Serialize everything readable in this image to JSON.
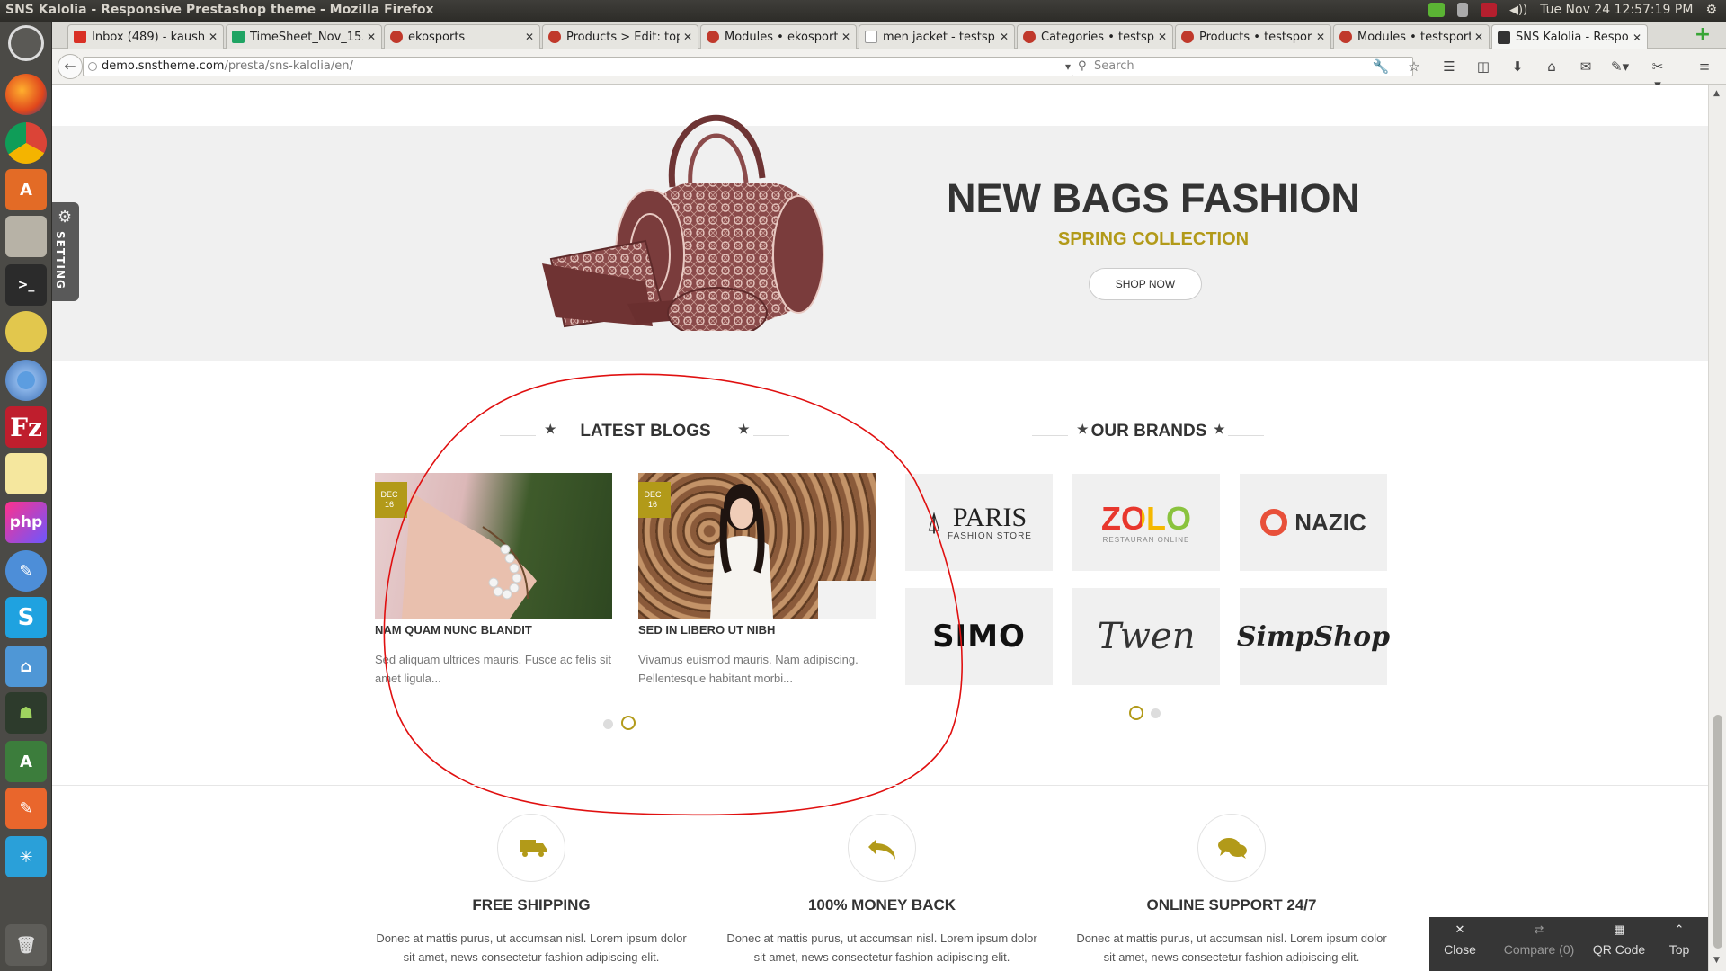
{
  "os": {
    "window_title": "SNS Kalolia - Responsive Prestashop theme - Mozilla Firefox",
    "clock": "Tue Nov 24 12:57:19 PM"
  },
  "tabs": [
    {
      "label": "Inbox (489) - kausha...",
      "favicon": "gmail-icon",
      "color": "#d93025"
    },
    {
      "label": "TimeSheet_Nov_15...",
      "favicon": "drive-icon",
      "color": "#1fa463"
    },
    {
      "label": "ekosports",
      "favicon": "prestashop-icon",
      "color": "#c0392b"
    },
    {
      "label": "Products > Edit: top...",
      "favicon": "prestashop-icon",
      "color": "#c0392b"
    },
    {
      "label": "Modules • ekosports",
      "favicon": "prestashop-icon",
      "color": "#c0392b"
    },
    {
      "label": "men jacket - testsp...",
      "favicon": "unknown-page-icon",
      "color": "#888888"
    },
    {
      "label": "Categories • testsp...",
      "favicon": "prestashop-icon",
      "color": "#c0392b"
    },
    {
      "label": "Products • testsports",
      "favicon": "prestashop-icon",
      "color": "#c0392b"
    },
    {
      "label": "Modules • testsports",
      "favicon": "prestashop-icon",
      "color": "#c0392b"
    },
    {
      "label": "SNS Kalolia - Respo...",
      "favicon": "sns-icon",
      "color": "#333333"
    }
  ],
  "navbar": {
    "url_domain": "demo.snstheme.com",
    "url_path": "/presta/sns-kalolia/en/",
    "search_placeholder": "Search"
  },
  "banner": {
    "setting_label": "SETTING",
    "title": "NEW BAGS FASHION",
    "subtitle": "SPRING COLLECTION",
    "cta": "SHOP NOW"
  },
  "blogs": {
    "heading": "LATEST BLOGS",
    "posts": [
      {
        "month": "DEC",
        "day": "16",
        "title": "NAM QUAM NUNC BLANDIT",
        "excerpt": "Sed aliquam ultrices mauris. Fusce ac felis sit amet ligula..."
      },
      {
        "month": "DEC",
        "day": "16",
        "title": "SED IN LIBERO UT NIBH",
        "excerpt": "Vivamus euismod mauris. Nam adipiscing. Pellentesque habitant morbi..."
      }
    ]
  },
  "brands": {
    "heading": "OUR BRANDS",
    "items": [
      {
        "name": "PARIS",
        "tagline": "FASHION STORE"
      },
      {
        "name": "ZOLO",
        "tagline": "RESTAURAN ONLINE"
      },
      {
        "name": "NAZIC",
        "tagline": ""
      },
      {
        "name": "SIMO",
        "tagline": ""
      },
      {
        "name": "Twen",
        "tagline": ""
      },
      {
        "name": "SimpShop",
        "tagline": ""
      }
    ]
  },
  "features": [
    {
      "title": "FREE SHIPPING",
      "text": "Donec at mattis purus, ut accumsan nisl. Lorem ipsum dolor sit amet, news consectetur fashion adipiscing elit.",
      "icon": "truck-icon"
    },
    {
      "title": "100% MONEY BACK",
      "text": "Donec at mattis purus, ut accumsan nisl. Lorem ipsum dolor sit amet, news consectetur fashion adipiscing elit.",
      "icon": "reply-arrow-icon"
    },
    {
      "title": "ONLINE SUPPORT 24/7",
      "text": "Donec at mattis purus, ut accumsan nisl. Lorem ipsum dolor sit amet, news consectetur fashion adipiscing elit.",
      "icon": "chat-bubbles-icon"
    }
  ],
  "bottom_bar": {
    "close": "Close",
    "compare": "Compare (0)",
    "qr": "QR Code",
    "top": "Top"
  },
  "colors": {
    "accent": "#b29a19",
    "annotation": "#e01010"
  }
}
